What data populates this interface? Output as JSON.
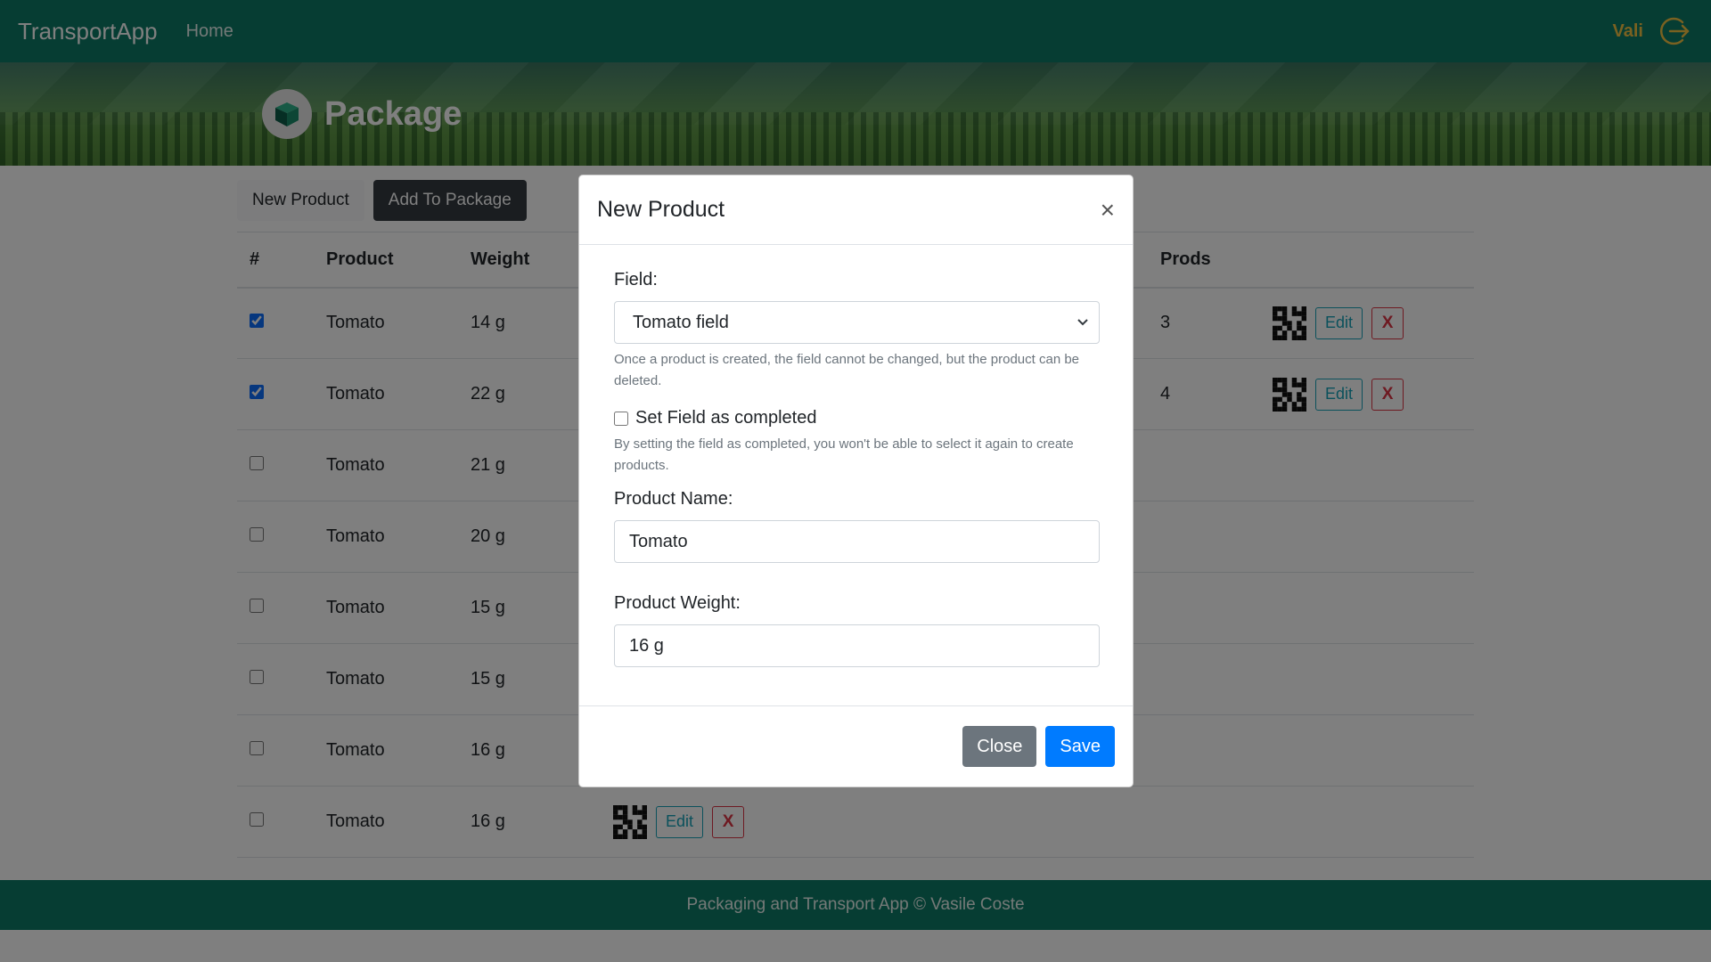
{
  "navbar": {
    "brand": "TransportApp",
    "home": "Home",
    "user": "Vali",
    "logout_icon": "logout-icon",
    "bg_color": "#0c7a66"
  },
  "hero": {
    "title": "Package",
    "icon": "package-icon"
  },
  "toolbar": {
    "new_product": "New Product",
    "add_to_package": "Add To Package"
  },
  "table": {
    "headers": {
      "num": "#",
      "product": "Product",
      "weight": "Weight",
      "prods": "Prods"
    },
    "rows": [
      {
        "checked": true,
        "product": "Tomato",
        "weight": "14 g",
        "prods": "3",
        "edit": "Edit",
        "delete": "X"
      },
      {
        "checked": true,
        "product": "Tomato",
        "weight": "22 g",
        "prods": "4",
        "edit": "Edit",
        "delete": "X"
      },
      {
        "checked": false,
        "product": "Tomato",
        "weight": "21 g"
      },
      {
        "checked": false,
        "product": "Tomato",
        "weight": "20 g"
      },
      {
        "checked": false,
        "product": "Tomato",
        "weight": "15 g"
      },
      {
        "checked": false,
        "product": "Tomato",
        "weight": "15 g"
      },
      {
        "checked": false,
        "product": "Tomato",
        "weight": "16 g"
      },
      {
        "checked": false,
        "product": "Tomato",
        "weight": "16 g",
        "edit": "Edit",
        "delete": "X"
      }
    ]
  },
  "footer": {
    "text": "Packaging and Transport App © Vasile Coste"
  },
  "modal": {
    "title": "New Product",
    "close_symbol": "×",
    "field_label": "Field:",
    "field_value": "Tomato field",
    "field_help": "Once a product is created, the field cannot be changed, but the product can be deleted.",
    "completed_label": "Set Field as completed",
    "completed_checked": false,
    "completed_help": "By setting the field as completed, you won't be able to select it again to create products.",
    "name_label": "Product Name:",
    "name_value": "Tomato",
    "weight_label": "Product Weight:",
    "weight_value": "16 g",
    "close_button": "Close",
    "save_button": "Save"
  }
}
